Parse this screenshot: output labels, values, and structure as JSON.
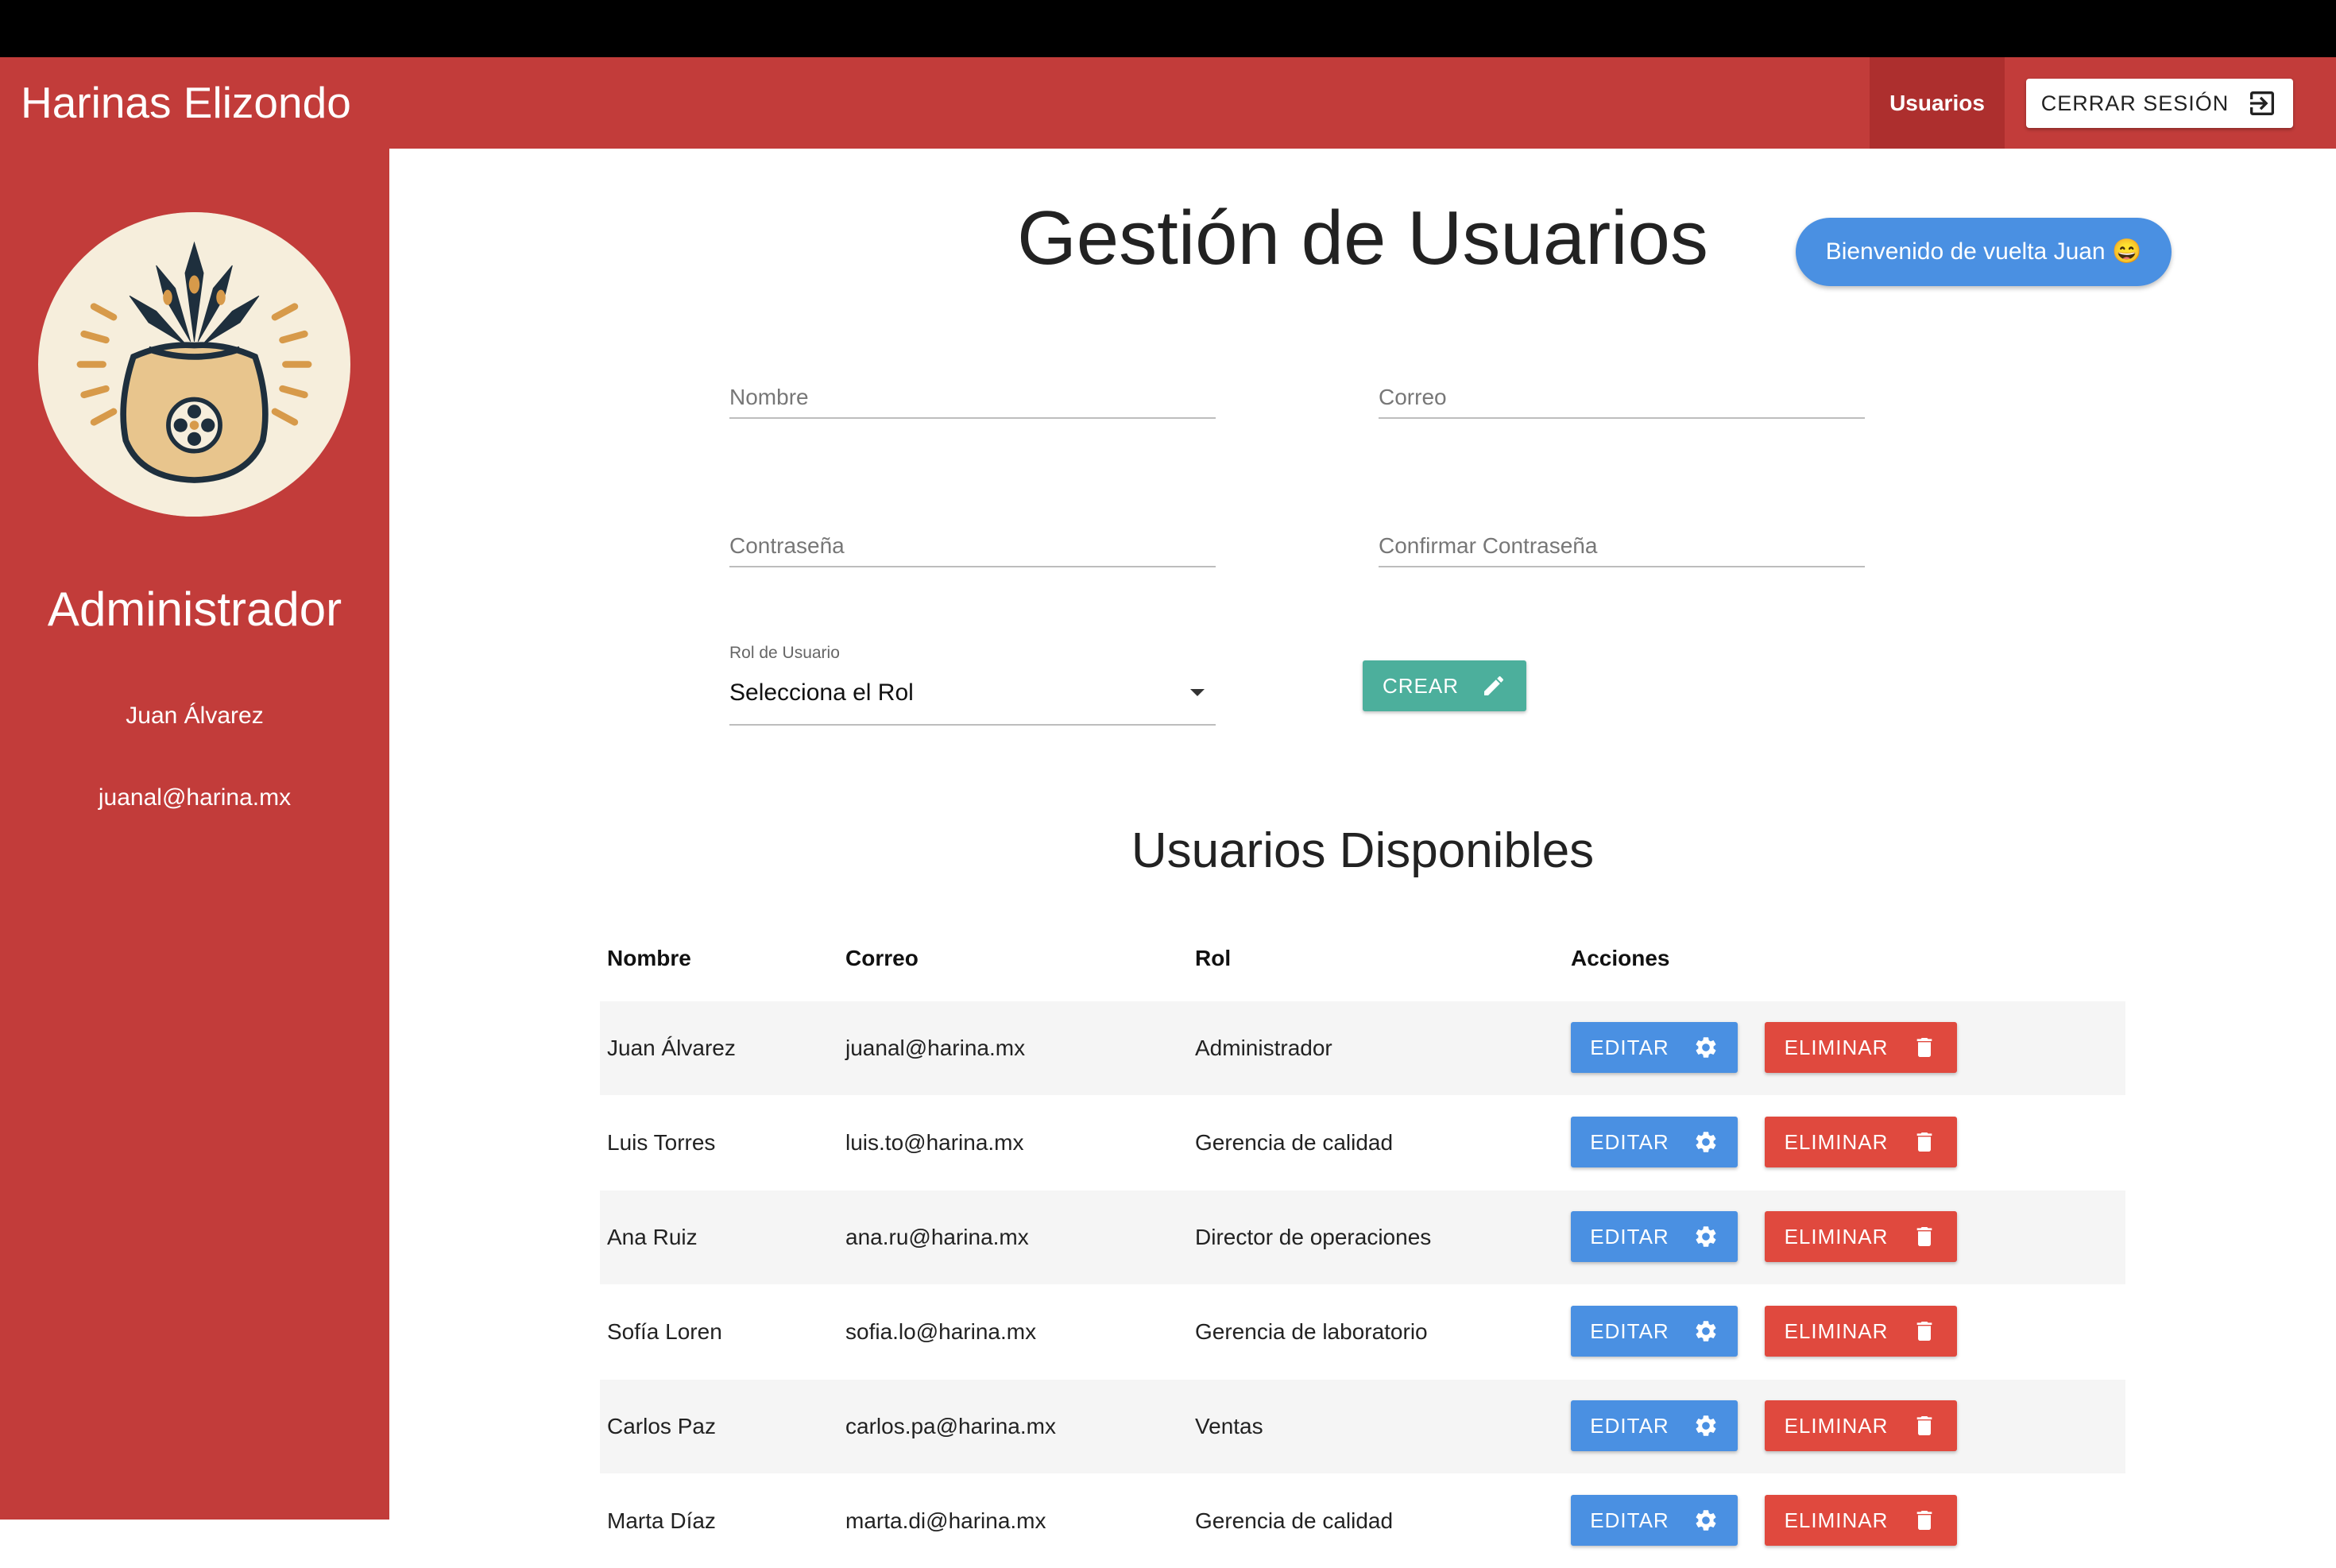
{
  "navbar": {
    "brand": "Harinas Elizondo",
    "nav_link": "Usuarios",
    "logout_label": "CERRAR SESIÓN"
  },
  "sidebar": {
    "role": "Administrador",
    "user_name": "Juan Álvarez",
    "user_email": "juanal@harina.mx"
  },
  "main": {
    "title": "Gestión de Usuarios",
    "welcome": "Bienvenido de vuelta Juan 😄",
    "form": {
      "name_placeholder": "Nombre",
      "email_placeholder": "Correo",
      "password_placeholder": "Contraseña",
      "confirm_placeholder": "Confirmar Contraseña",
      "role_label": "Rol de Usuario",
      "role_value": "Selecciona el Rol",
      "create_label": "CREAR"
    },
    "table_title": "Usuarios Disponibles",
    "columns": [
      "Nombre",
      "Correo",
      "Rol",
      "Acciones"
    ],
    "edit_label": "EDITAR",
    "delete_label": "ELIMINAR",
    "rows": [
      {
        "name": "Juan Álvarez",
        "email": "juanal@harina.mx",
        "role": "Administrador"
      },
      {
        "name": "Luis Torres",
        "email": "luis.to@harina.mx",
        "role": "Gerencia de calidad"
      },
      {
        "name": "Ana Ruiz",
        "email": "ana.ru@harina.mx",
        "role": "Director de operaciones"
      },
      {
        "name": "Sofía Loren",
        "email": "sofia.lo@harina.mx",
        "role": "Gerencia de laboratorio"
      },
      {
        "name": "Carlos Paz",
        "email": "carlos.pa@harina.mx",
        "role": "Ventas"
      },
      {
        "name": "Marta Díaz",
        "email": "marta.di@harina.mx",
        "role": "Gerencia de calidad"
      }
    ]
  },
  "colors": {
    "primary_red": "#c23c3a",
    "active_nav": "#ad2f2e",
    "blue": "#4a90e2",
    "teal": "#4caf9c",
    "danger": "#e0493e"
  }
}
